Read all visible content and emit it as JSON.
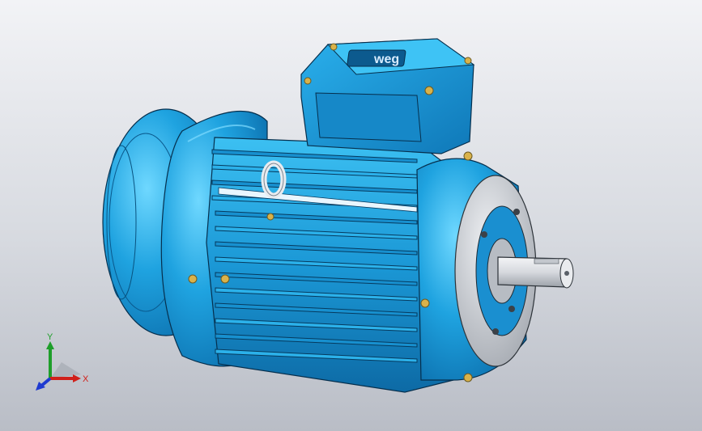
{
  "viewport": {
    "background": "#d7dae0",
    "model": {
      "name": "electric-motor",
      "body_color": "#1a9ad8",
      "body_highlight": "#5fd0ff",
      "shadow_color": "#0a5f94",
      "flange_color": "#c9ccd2",
      "shaft_color": "#dfe2e6",
      "brass_color": "#d9b24a",
      "logo_text": "weg"
    },
    "triad": {
      "x_label": "X",
      "y_label": "Y",
      "x_color": "#d0201a",
      "y_color": "#1e9e2a",
      "z_color": "#1f3ad0"
    }
  }
}
